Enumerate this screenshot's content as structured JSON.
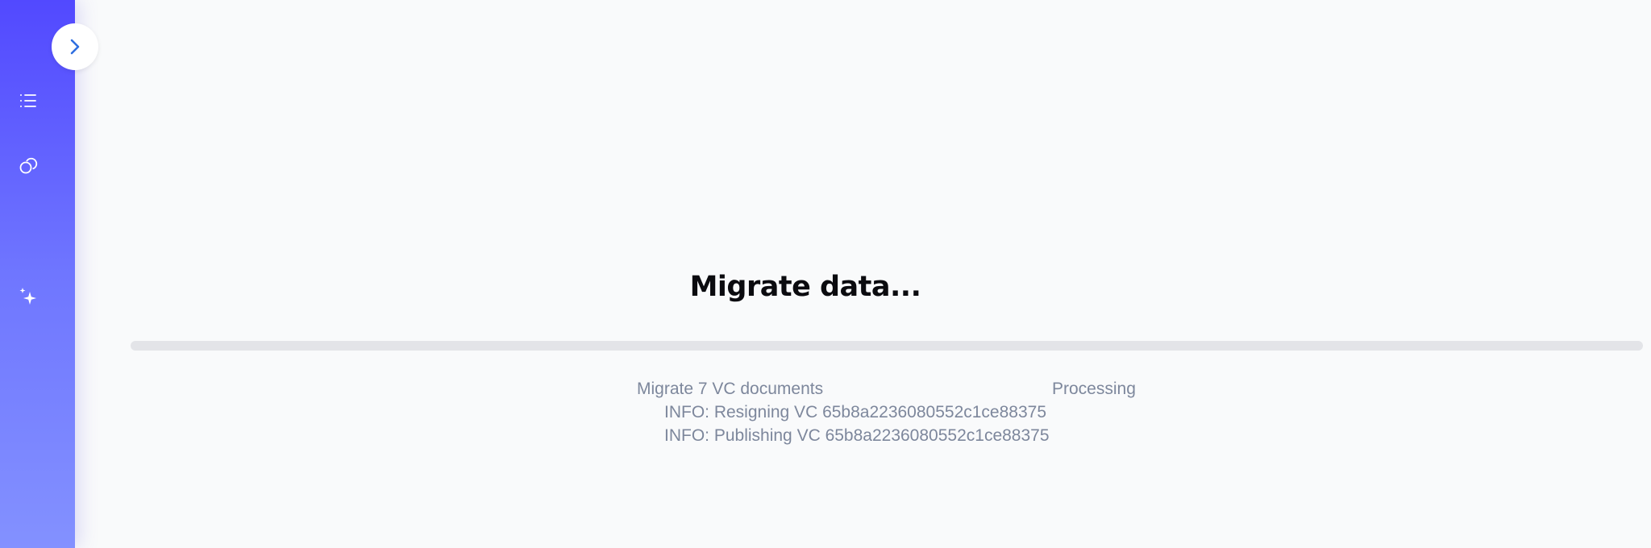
{
  "sidebar": {
    "toggle_icon": "chevron-right-icon",
    "items": [
      {
        "icon": "list-icon"
      },
      {
        "icon": "linked-circles-icon"
      },
      {
        "icon": "sparkles-icon"
      }
    ]
  },
  "main": {
    "title": "Migrate data...",
    "progress": {
      "value": 0,
      "track_color": "#e3e4e8"
    },
    "task": {
      "label": "Migrate 7 VC documents",
      "status": "Processing"
    },
    "log": [
      "INFO: Resigning VC 65b8a2236080552c1ce88375",
      "INFO: Publishing VC 65b8a2236080552c1ce88375"
    ]
  },
  "colors": {
    "sidebar_top": "#5249ff",
    "sidebar_bottom": "#8391ff",
    "accent": "#2f6fe0",
    "log_text": "#7d879c"
  }
}
